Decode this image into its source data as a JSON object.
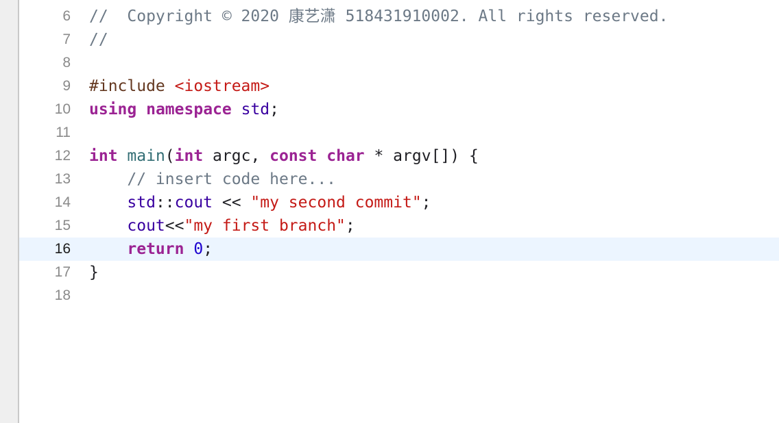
{
  "editor": {
    "current_line": "16",
    "lines": [
      {
        "num": "6",
        "tokens": [
          {
            "cls": "comment",
            "text": "//  Copyright © 2020 康艺潇 518431910002. All rights reserved."
          }
        ]
      },
      {
        "num": "7",
        "tokens": [
          {
            "cls": "comment",
            "text": "//"
          }
        ]
      },
      {
        "num": "8",
        "tokens": []
      },
      {
        "num": "9",
        "tokens": [
          {
            "cls": "preproc",
            "text": "#include "
          },
          {
            "cls": "string",
            "text": "<iostream>"
          }
        ]
      },
      {
        "num": "10",
        "tokens": [
          {
            "cls": "keyword",
            "text": "using"
          },
          {
            "cls": "",
            "text": " "
          },
          {
            "cls": "keyword",
            "text": "namespace"
          },
          {
            "cls": "",
            "text": " "
          },
          {
            "cls": "type",
            "text": "std"
          },
          {
            "cls": "",
            "text": ";"
          }
        ]
      },
      {
        "num": "11",
        "tokens": []
      },
      {
        "num": "12",
        "tokens": [
          {
            "cls": "keyword",
            "text": "int"
          },
          {
            "cls": "",
            "text": " "
          },
          {
            "cls": "func",
            "text": "main"
          },
          {
            "cls": "",
            "text": "("
          },
          {
            "cls": "keyword",
            "text": "int"
          },
          {
            "cls": "",
            "text": " argc, "
          },
          {
            "cls": "keyword",
            "text": "const"
          },
          {
            "cls": "",
            "text": " "
          },
          {
            "cls": "keyword",
            "text": "char"
          },
          {
            "cls": "",
            "text": " * argv[]) {"
          }
        ]
      },
      {
        "num": "13",
        "tokens": [
          {
            "cls": "",
            "text": "    "
          },
          {
            "cls": "comment",
            "text": "// insert code here..."
          }
        ]
      },
      {
        "num": "14",
        "tokens": [
          {
            "cls": "",
            "text": "    "
          },
          {
            "cls": "type",
            "text": "std"
          },
          {
            "cls": "",
            "text": "::"
          },
          {
            "cls": "type",
            "text": "cout"
          },
          {
            "cls": "",
            "text": " << "
          },
          {
            "cls": "string",
            "text": "\"my second commit\""
          },
          {
            "cls": "",
            "text": ";"
          }
        ]
      },
      {
        "num": "15",
        "tokens": [
          {
            "cls": "",
            "text": "    "
          },
          {
            "cls": "type",
            "text": "cout"
          },
          {
            "cls": "",
            "text": "<<"
          },
          {
            "cls": "string",
            "text": "\"my first branch\""
          },
          {
            "cls": "",
            "text": ";"
          }
        ]
      },
      {
        "num": "16",
        "tokens": [
          {
            "cls": "",
            "text": "    "
          },
          {
            "cls": "keyword",
            "text": "return"
          },
          {
            "cls": "",
            "text": " "
          },
          {
            "cls": "number",
            "text": "0"
          },
          {
            "cls": "",
            "text": ";"
          }
        ]
      },
      {
        "num": "17",
        "tokens": [
          {
            "cls": "",
            "text": "}"
          }
        ]
      },
      {
        "num": "18",
        "tokens": []
      }
    ]
  }
}
